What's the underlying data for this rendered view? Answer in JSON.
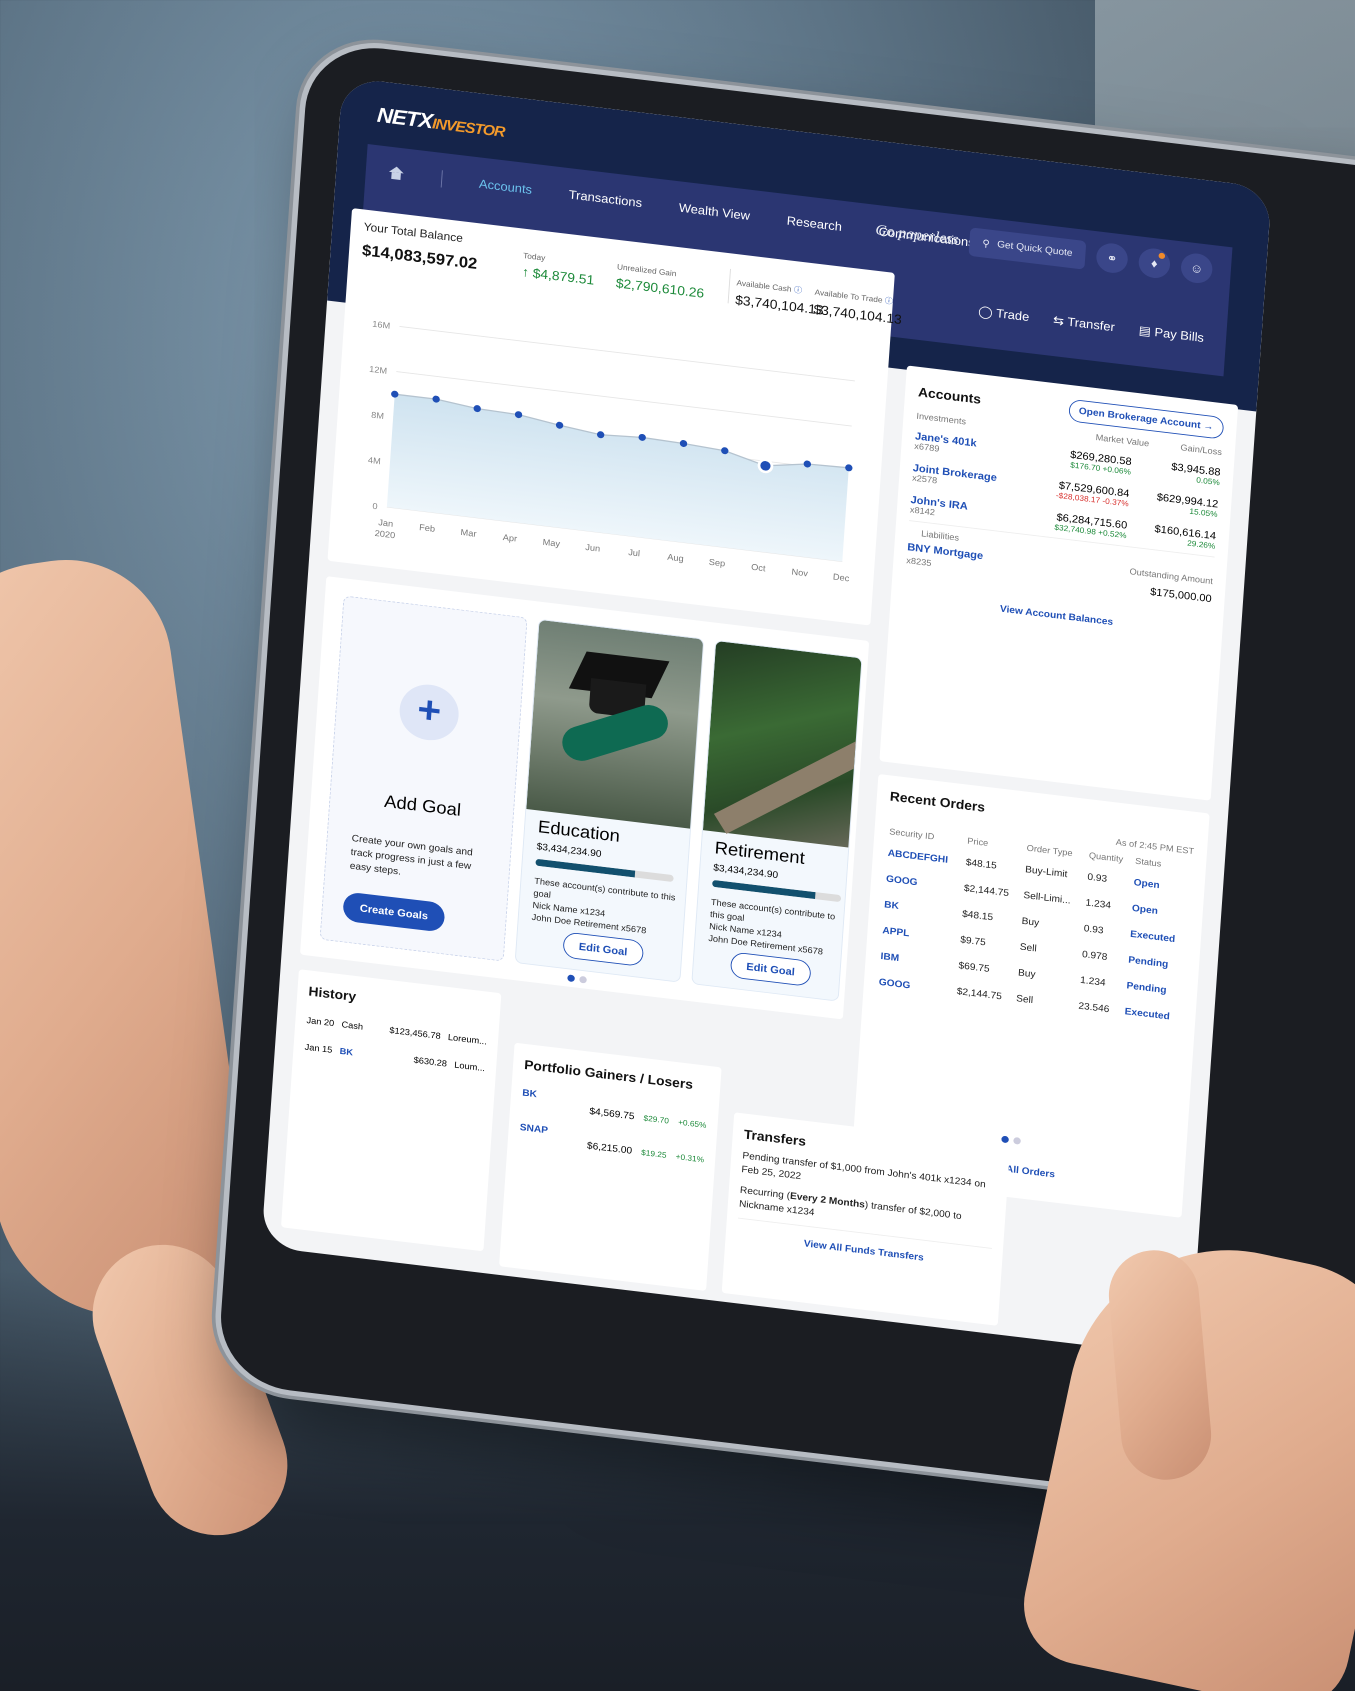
{
  "brand": {
    "part1": "NETX",
    "part2": "INVESTOR"
  },
  "nav": {
    "items": [
      "Accounts",
      "Transactions",
      "Wealth View",
      "Research",
      "Communications"
    ],
    "active": "Accounts",
    "paperless": "Go paperless",
    "quote_placeholder": "Get Quick Quote"
  },
  "actions": {
    "trade": "Trade",
    "transfer": "Transfer",
    "pay_bills": "Pay Bills"
  },
  "balance": {
    "title": "Your Total Balance",
    "total": "$14,083,597.02",
    "today_label": "Today",
    "today_value": "$4,879.51",
    "unrealized_label": "Unrealized Gain",
    "unrealized_value": "$2,790,610.26",
    "cash_label": "Available Cash",
    "cash_value": "$3,740,104.13",
    "trade_label": "Available To Trade",
    "trade_value": "$3,740,104.13"
  },
  "chart_data": {
    "type": "area",
    "x": [
      "Jan 2020",
      "Feb",
      "Mar",
      "Apr",
      "May",
      "Jun",
      "Jul",
      "Aug",
      "Sep",
      "Oct",
      "Nov",
      "Dec"
    ],
    "values": [
      10.0,
      10.0,
      9.6,
      9.5,
      9.0,
      8.6,
      8.8,
      8.7,
      8.5,
      7.6,
      8.2,
      8.3
    ],
    "y_ticks": [
      "0",
      "4M",
      "8M",
      "12M",
      "16M"
    ],
    "ylim": [
      0,
      16
    ],
    "y_unit": "M",
    "highlight_index": 9,
    "grid": true,
    "color": "#1f4fb6"
  },
  "accounts": {
    "title": "Accounts",
    "open_button": "Open Brokerage Account",
    "investments_label": "Investments",
    "market_value_label": "Market Value",
    "gain_loss_label": "Gain/Loss",
    "items": [
      {
        "name": "Jane's 401k",
        "num": "x6789",
        "value": "$269,280.58",
        "day": "$176.70",
        "day_pct": "+0.06%",
        "gain": "$3,945.88",
        "gain_pct": "0.05%",
        "neg": false
      },
      {
        "name": "Joint Brokerage",
        "num": "x2578",
        "value": "$7,529,600.84",
        "day": "-$28,038.17",
        "day_pct": "-0.37%",
        "gain": "$629,994.12",
        "gain_pct": "15.05%",
        "neg": true
      },
      {
        "name": "John's IRA",
        "num": "x8142",
        "value": "$6,284,715.60",
        "day": "$32,740.98",
        "day_pct": "+0.52%",
        "gain": "$160,616.14",
        "gain_pct": "29.26%",
        "neg": false
      }
    ],
    "liabilities_label": "Liabilities",
    "outstanding_label": "Outstanding Amount",
    "liability": {
      "name": "BNY Mortgage",
      "num": "x8235",
      "amount": "$175,000.00"
    },
    "view_link": "View Account Balances"
  },
  "goals": {
    "add": {
      "title": "Add Goal",
      "desc": "Create your own goals and track progress in just a few easy steps.",
      "button": "Create Goals"
    },
    "cards": [
      {
        "title": "Education",
        "amount": "$3,434,234.90",
        "progress": 0.72,
        "note": "These account(s) contribute to this goal",
        "acct1": "Nick Name x1234",
        "acct2": "John Doe Retirement x5678",
        "button": "Edit Goal"
      },
      {
        "title": "Retirement",
        "amount": "$3,434,234.90",
        "progress": 0.8,
        "note": "These account(s) contribute to this goal",
        "acct1": "Nick Name x1234",
        "acct2": "John Doe Retirement x5678",
        "button": "Edit Goal"
      }
    ]
  },
  "orders": {
    "title": "Recent Orders",
    "as_of": "As of 2:45 PM EST",
    "headers": [
      "Security ID",
      "Price",
      "Order Type",
      "Quantity",
      "Status"
    ],
    "rows": [
      [
        "ABCDEFGHI",
        "$48.15",
        "Buy-Limit",
        "0.93",
        "Open"
      ],
      [
        "GOOG",
        "$2,144.75",
        "Sell-Limi...",
        "1.234",
        "Open"
      ],
      [
        "BK",
        "$48.15",
        "Buy",
        "0.93",
        "Executed"
      ],
      [
        "APPL",
        "$9.75",
        "Sell",
        "0.978",
        "Pending"
      ],
      [
        "IBM",
        "$69.75",
        "Buy",
        "1.234",
        "Pending"
      ],
      [
        "GOOG",
        "$2,144.75",
        "Sell",
        "23.546",
        "Executed"
      ]
    ],
    "view_link": "View All Orders"
  },
  "history": {
    "title": "History",
    "rows": [
      {
        "date": "Jan 20",
        "desc": "Cash",
        "amount": "$123,456.78",
        "note": "Loreum..."
      },
      {
        "date": "Jan 15",
        "desc": "BK",
        "amount": "$630.28",
        "note": "Loum..."
      }
    ]
  },
  "gainers": {
    "title": "Portfolio Gainers / Losers",
    "rows": [
      {
        "sym": "BK",
        "price": "$4,569.75",
        "chg": "$29.70",
        "pct": "+0.65%"
      },
      {
        "sym": "SNAP",
        "price": "$6,215.00",
        "chg": "$19.25",
        "pct": "+0.31%"
      }
    ]
  },
  "transfers": {
    "title": "Transfers",
    "item1": "Pending transfer of $1,000 from John's 401k x1234 on Feb 25, 2022",
    "item2_pre": "Recurring (",
    "item2_bold": "Every 2 Months",
    "item2_post": ") transfer of $2,000 to Nickname x1234",
    "view_link": "View All Funds Transfers"
  }
}
